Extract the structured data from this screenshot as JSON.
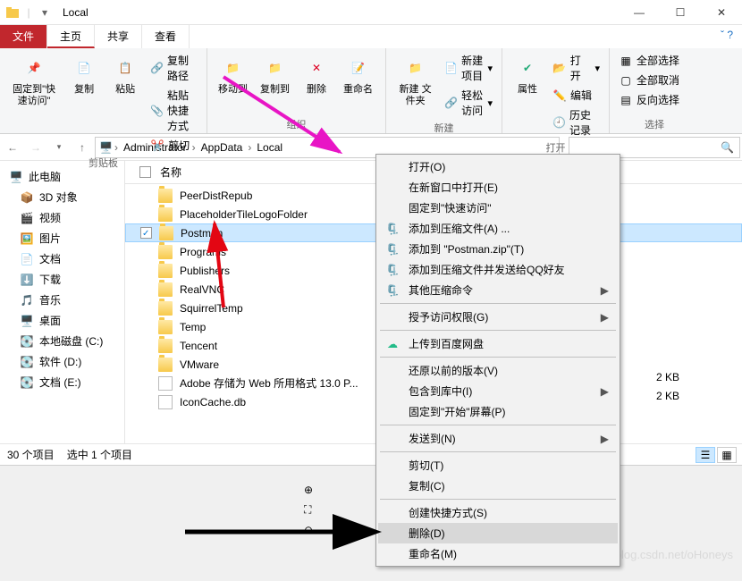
{
  "window": {
    "title": "Local"
  },
  "tabs": {
    "file": "文件",
    "home": "主页",
    "share": "共享",
    "view": "查看"
  },
  "ribbon": {
    "clipboard": {
      "label": "剪贴板",
      "pin": "固定到\"快\n速访问\"",
      "copy": "复制",
      "paste": "粘贴",
      "copypath": "复制路径",
      "pasteshort": "粘贴快捷方式",
      "cut": "剪切"
    },
    "organize": {
      "label": "组织",
      "moveto": "移动到",
      "copyto": "复制到",
      "delete": "删除",
      "rename": "重命名"
    },
    "new": {
      "label": "新建",
      "newfolder": "新建\n文件夹",
      "newitem": "新建项目",
      "easyaccess": "轻松访问"
    },
    "open": {
      "label": "打开",
      "props": "属性",
      "open": "打开",
      "edit": "编辑",
      "history": "历史记录"
    },
    "select": {
      "label": "选择",
      "all": "全部选择",
      "none": "全部取消",
      "invert": "反向选择"
    }
  },
  "breadcrumbs": [
    "Administrator",
    "AppData",
    "Local"
  ],
  "columns": {
    "name": "名称"
  },
  "sidebar": {
    "thispc": "此电脑",
    "items": [
      "3D 对象",
      "视频",
      "图片",
      "文档",
      "下载",
      "音乐",
      "桌面",
      "本地磁盘 (C:)",
      "软件 (D:)",
      "文档 (E:)"
    ]
  },
  "files": [
    {
      "name": "PeerDistRepub",
      "type": "folder"
    },
    {
      "name": "PlaceholderTileLogoFolder",
      "type": "folder"
    },
    {
      "name": "Postman",
      "type": "folder",
      "selected": true
    },
    {
      "name": "Programs",
      "type": "folder"
    },
    {
      "name": "Publishers",
      "type": "folder"
    },
    {
      "name": "RealVNC",
      "type": "folder"
    },
    {
      "name": "SquirrelTemp",
      "type": "folder"
    },
    {
      "name": "Temp",
      "type": "folder"
    },
    {
      "name": "Tencent",
      "type": "folder"
    },
    {
      "name": "VMware",
      "type": "folder"
    },
    {
      "name": "Adobe 存储为 Web 所用格式 13.0 P...",
      "type": "file"
    },
    {
      "name": "IconCache.db",
      "type": "file"
    }
  ],
  "sizecol": [
    "2 KB",
    "2 KB"
  ],
  "status": {
    "items": "30 个项目",
    "selected": "选中 1 个项目"
  },
  "context": [
    {
      "t": "打开(O)"
    },
    {
      "t": "在新窗口中打开(E)"
    },
    {
      "t": "固定到\"快速访问\""
    },
    {
      "t": "添加到压缩文件(A) ...",
      "ic": "arc"
    },
    {
      "t": "添加到 \"Postman.zip\"(T)",
      "ic": "arc"
    },
    {
      "t": "添加到压缩文件并发送给QQ好友",
      "ic": "arc"
    },
    {
      "t": "其他压缩命令",
      "ic": "arc",
      "sub": true
    },
    {
      "sep": true
    },
    {
      "t": "授予访问权限(G)",
      "sub": true
    },
    {
      "sep": true
    },
    {
      "t": "上传到百度网盘",
      "ic": "cloud"
    },
    {
      "sep": true
    },
    {
      "t": "还原以前的版本(V)"
    },
    {
      "t": "包含到库中(I)",
      "sub": true
    },
    {
      "t": "固定到\"开始\"屏幕(P)"
    },
    {
      "sep": true
    },
    {
      "t": "发送到(N)",
      "sub": true
    },
    {
      "sep": true
    },
    {
      "t": "剪切(T)"
    },
    {
      "t": "复制(C)"
    },
    {
      "sep": true
    },
    {
      "t": "创建快捷方式(S)"
    },
    {
      "t": "删除(D)",
      "hov": true
    },
    {
      "t": "重命名(M)"
    }
  ],
  "watermark": "https://blog.csdn.net/oHoneys"
}
